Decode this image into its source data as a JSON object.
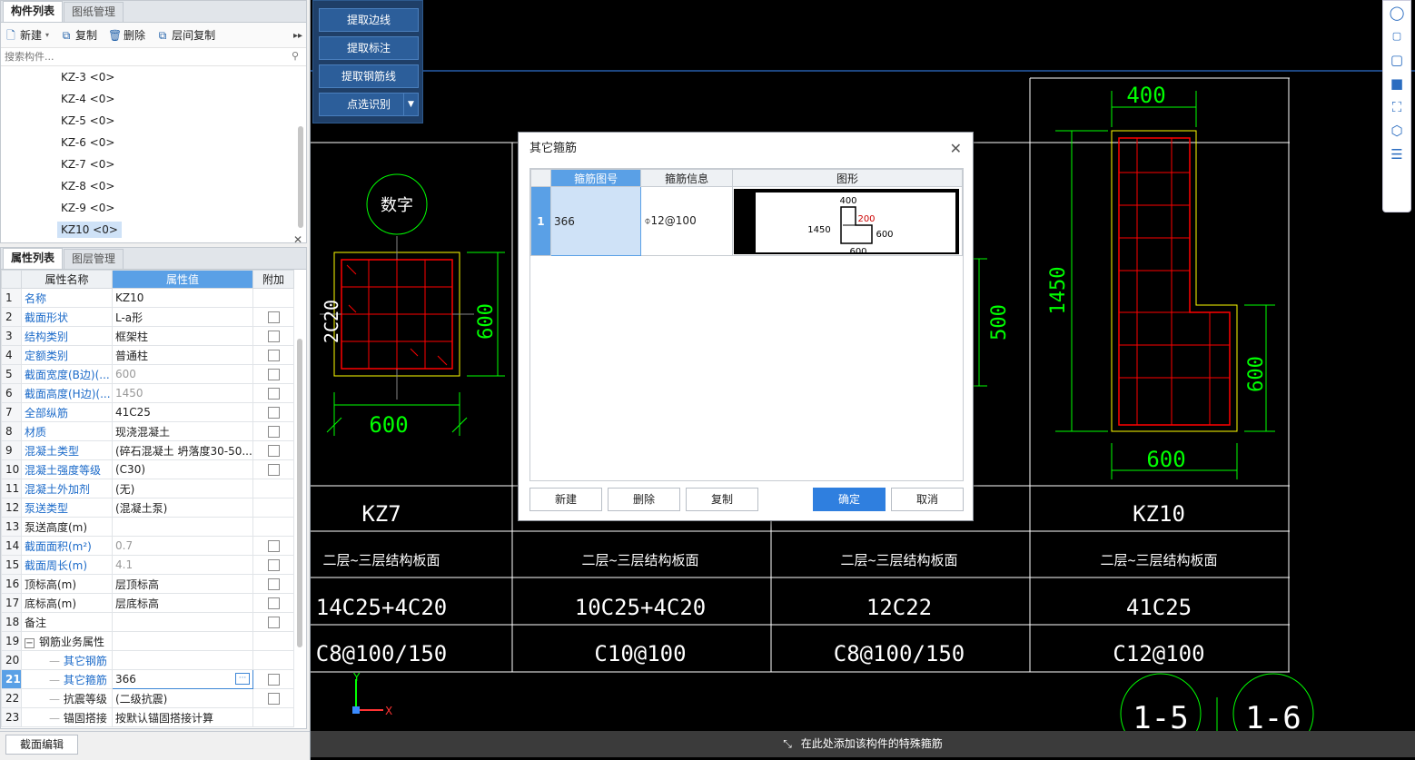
{
  "component_panel": {
    "tabs": [
      "构件列表",
      "图纸管理"
    ],
    "toolbar": {
      "new": "新建",
      "copy": "复制",
      "delete": "删除",
      "floor_copy": "层间复制"
    },
    "search_placeholder": "搜索构件...",
    "items": [
      "KZ-3 <0>",
      "KZ-4 <0>",
      "KZ-5 <0>",
      "KZ-6 <0>",
      "KZ-7 <0>",
      "KZ-8 <0>",
      "KZ-9 <0>",
      "KZ10 <0>"
    ],
    "selected_item": "KZ10 <0>"
  },
  "property_panel": {
    "tabs": [
      "属性列表",
      "图层管理"
    ],
    "columns": [
      "属性名称",
      "属性值",
      "附加"
    ],
    "rows": [
      {
        "no": "1",
        "name": "名称",
        "value": "KZ10"
      },
      {
        "no": "2",
        "name": "截面形状",
        "value": "L-a形"
      },
      {
        "no": "3",
        "name": "结构类别",
        "value": "框架柱"
      },
      {
        "no": "4",
        "name": "定额类别",
        "value": "普通柱"
      },
      {
        "no": "5",
        "name": "截面宽度(B边)(...",
        "value": "600"
      },
      {
        "no": "6",
        "name": "截面高度(H边)(...",
        "value": "1450"
      },
      {
        "no": "7",
        "name": "全部纵筋",
        "value": "41C25"
      },
      {
        "no": "8",
        "name": "材质",
        "value": "现浇混凝土"
      },
      {
        "no": "9",
        "name": "混凝土类型",
        "value": "(碎石混凝土 坍落度30-50..."
      },
      {
        "no": "10",
        "name": "混凝土强度等级",
        "value": "(C30)"
      },
      {
        "no": "11",
        "name": "混凝土外加剂",
        "value": "(无)"
      },
      {
        "no": "12",
        "name": "泵送类型",
        "value": "(混凝土泵)"
      },
      {
        "no": "13",
        "name": "泵送高度(m)",
        "value": ""
      },
      {
        "no": "14",
        "name": "截面面积(m²)",
        "value": "0.7"
      },
      {
        "no": "15",
        "name": "截面周长(m)",
        "value": "4.1"
      },
      {
        "no": "16",
        "name": "顶标高(m)",
        "value": "层顶标高"
      },
      {
        "no": "17",
        "name": "底标高(m)",
        "value": "层底标高"
      },
      {
        "no": "18",
        "name": "备注",
        "value": ""
      },
      {
        "no": "19",
        "name": "钢筋业务属性",
        "value": ""
      },
      {
        "no": "20",
        "name": "其它钢筋",
        "value": ""
      },
      {
        "no": "21",
        "name": "其它箍筋",
        "value": "366"
      },
      {
        "no": "22",
        "name": "抗震等级",
        "value": "(二级抗震)"
      },
      {
        "no": "23",
        "name": "锚固搭接",
        "value": "按默认锚固搭接计算"
      }
    ],
    "section_edit": "截面编辑"
  },
  "extract_panel": {
    "buttons": [
      "提取边线",
      "提取标注",
      "提取钢筋线",
      "点选识别"
    ]
  },
  "cad": {
    "dims": {
      "kz7_width": "600",
      "kz7_height": "600",
      "kz7_side": "2C20",
      "circle_label": "数字",
      "kz10_top": "400",
      "kz10_height": "1450",
      "kz10_right": "600",
      "kz10_bottom": "600",
      "mid_height": "500"
    },
    "table": {
      "names": [
        "KZ7",
        "KZ10"
      ],
      "levels": [
        "二层~三层结构板面",
        "二层~三层结构板面",
        "二层~三层结构板面",
        "二层~三层结构板面"
      ],
      "rebars": [
        "14C25+4C20",
        "10C25+4C20",
        "12C22",
        "41C25"
      ],
      "stirrups": [
        "C8@100/150",
        "C10@100",
        "C8@100/150",
        "C12@100"
      ]
    },
    "axis_circles": [
      "1-5",
      "1-6"
    ],
    "axis_x": "X",
    "axis_y": "Y"
  },
  "dialog": {
    "title": "其它箍筋",
    "columns": [
      "箍筋图号",
      "箍筋信息",
      "图形"
    ],
    "row": {
      "no": "1",
      "shape_no": "366",
      "info": "⌽12@100"
    },
    "shape_dims": {
      "top": "400",
      "left": "1450",
      "inner": "200",
      "right": "600",
      "bottom": "600"
    },
    "buttons": {
      "new": "新建",
      "delete": "删除",
      "copy": "复制",
      "ok": "确定",
      "cancel": "取消"
    }
  },
  "status": {
    "message": "在此处添加该构件的特殊箍筋"
  },
  "colors": {
    "accent": "#5aa0e6",
    "primary_button": "#2f7fdf",
    "cad_line": "#ffffff",
    "cad_dim": "#00ff00",
    "cad_rebar": "#ff0000",
    "cad_outline": "#ffff00",
    "cad_guide": "#3a8bff"
  }
}
